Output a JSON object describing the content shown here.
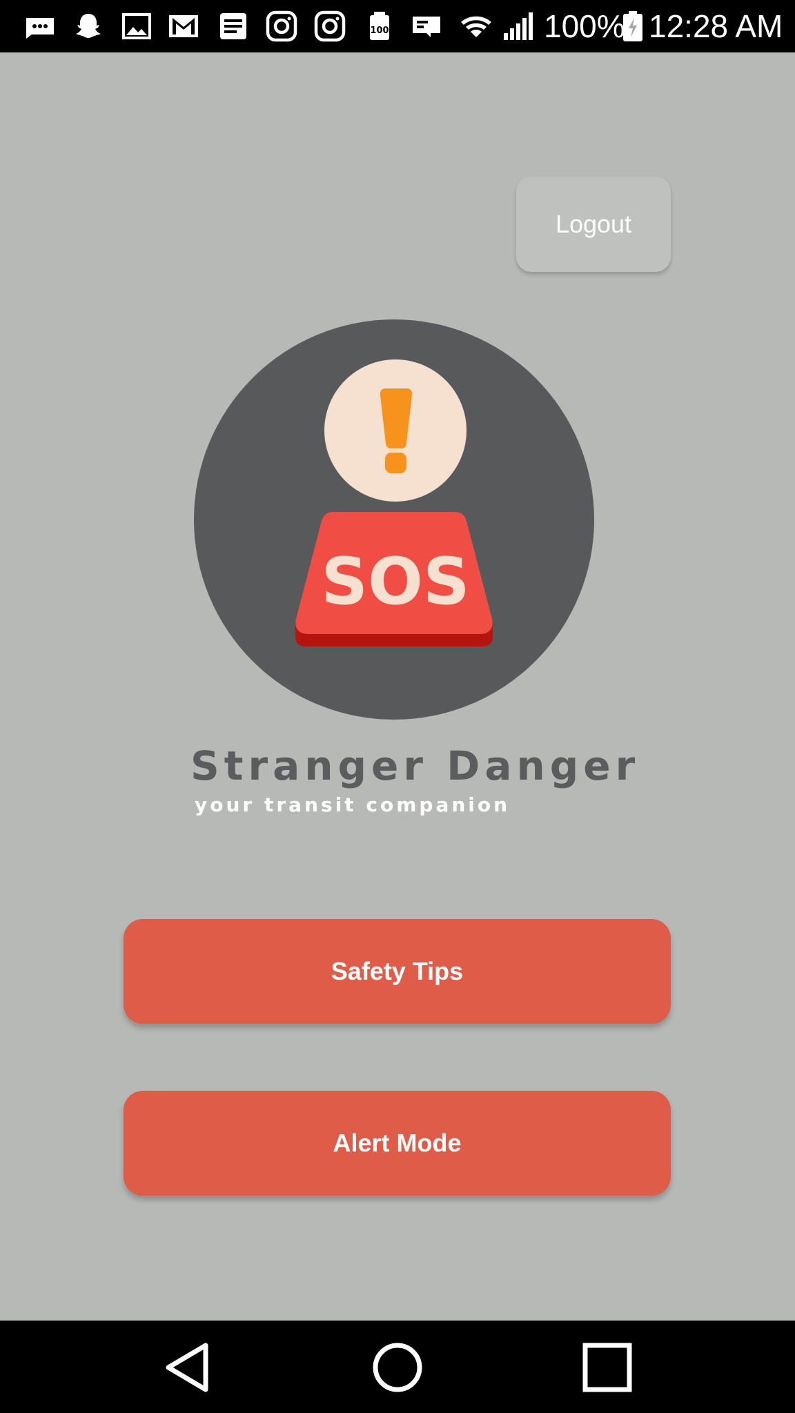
{
  "status_bar": {
    "battery_percent": "100%",
    "time": "12:28 AM",
    "icons": [
      "messages-icon",
      "snapchat-icon",
      "gallery-icon",
      "gmail-icon",
      "notes-icon",
      "instagram-icon",
      "instagram-icon",
      "storage-icon",
      "cast-icon",
      "wifi-icon",
      "signal-icon",
      "battery-charging-icon"
    ]
  },
  "header": {
    "logout_label": "Logout"
  },
  "logo": {
    "badge_text": "SOS",
    "title": "Stranger Danger",
    "subtitle": "your transit companion"
  },
  "actions": {
    "safety_tips_label": "Safety Tips",
    "alert_mode_label": "Alert Mode"
  },
  "colors": {
    "background": "#b6b9b6",
    "accent_button": "#df5c48",
    "logo_circle": "#58595b",
    "sos_red": "#f04e45",
    "exclamation_orange": "#f7931d",
    "cream": "#f6e0d0"
  },
  "nav_bar": {
    "icons": [
      "back-icon",
      "home-icon",
      "recents-icon"
    ]
  }
}
